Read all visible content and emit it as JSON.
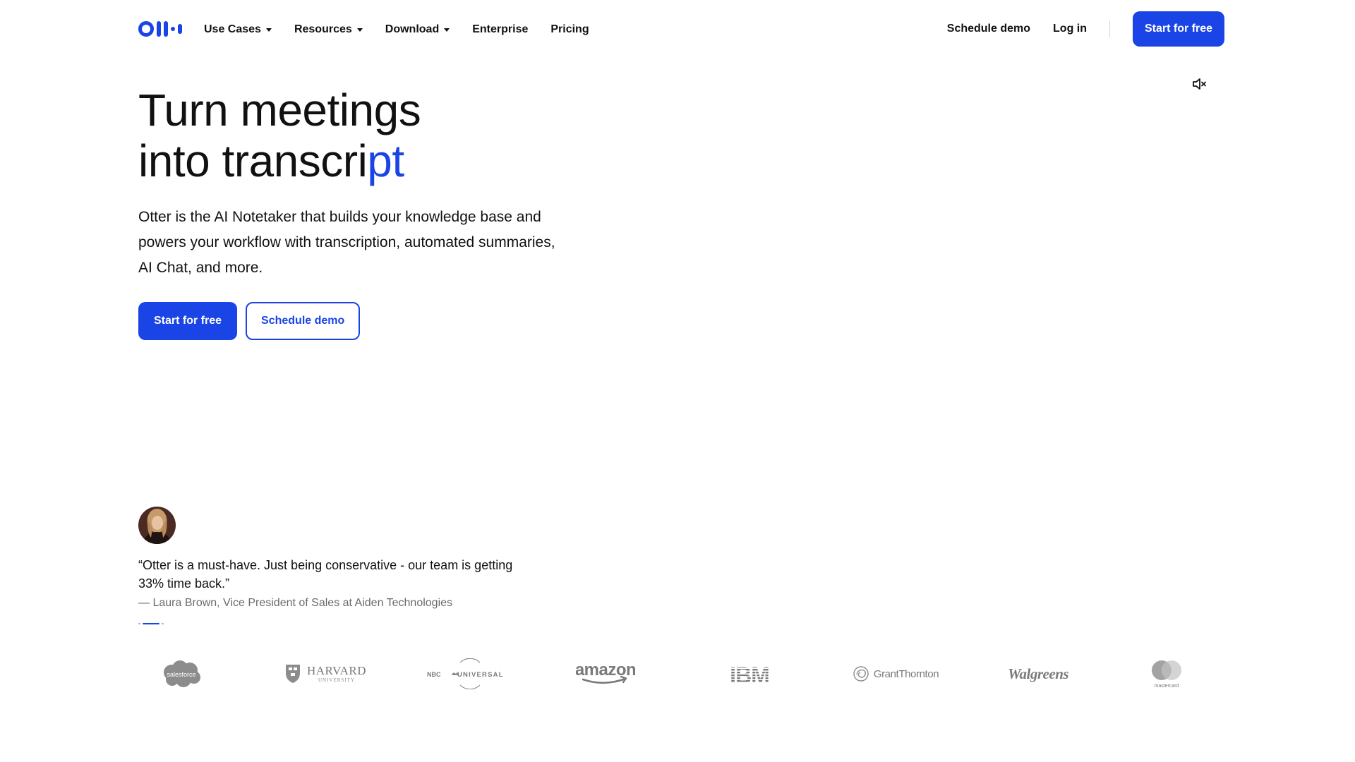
{
  "header": {
    "logo_name": "otter-logo",
    "nav": [
      {
        "label": "Use Cases",
        "has_caret": true
      },
      {
        "label": "Resources",
        "has_caret": true
      },
      {
        "label": "Download",
        "has_caret": true
      },
      {
        "label": "Enterprise",
        "has_caret": false
      },
      {
        "label": "Pricing",
        "has_caret": false
      }
    ],
    "schedule_demo": "Schedule demo",
    "log_in": "Log in",
    "start_free": "Start for free"
  },
  "hero": {
    "title_line1": "Turn meetings",
    "title_line2_main": "into transcri",
    "title_line2_accent": "pt",
    "subtitle": "Otter is the AI Notetaker that builds your knowledge base and powers your workflow with transcription, automated summaries, AI Chat, and more.",
    "primary_button": "Start for free",
    "secondary_button": "Schedule demo"
  },
  "testimonial": {
    "quote": "“Otter is a must-have. Just being conservative - our team is getting 33% time back.”",
    "attribution": "— Laura Brown, Vice President of Sales at Aiden Technologies"
  },
  "logos": {
    "salesforce": "salesforce",
    "harvard": "HARVARD",
    "harvard_sub": "UNIVERSITY",
    "nbc_left": "NBC",
    "nbc_right": "UNIVERSAL",
    "amazon": "amazon",
    "ibm": "IBM",
    "grant_thornton": "GrantThornton",
    "walgreens": "Walgreens",
    "mastercard": "mastercard"
  },
  "colors": {
    "brand_blue": "#1a44e6",
    "text": "#111111",
    "muted": "#6b6b6b"
  },
  "icons": {
    "mute": "speaker-muted-icon",
    "caret": "caret-down-icon"
  }
}
